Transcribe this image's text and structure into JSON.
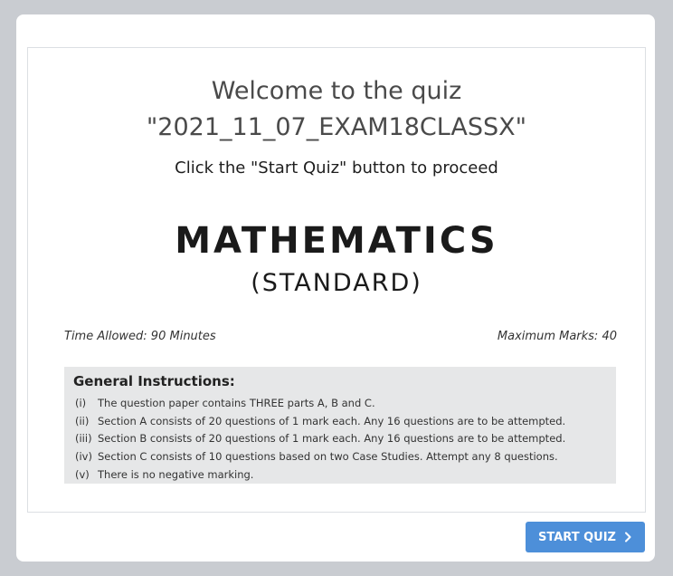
{
  "quiz": {
    "welcome_line": "Welcome to the quiz",
    "quiz_name": "\"2021_11_07_EXAM18CLASSX\"",
    "subtitle": "Click the \"Start Quiz\" button to proceed"
  },
  "paper": {
    "subject": "MATHEMATICS",
    "variant": "(STANDARD)",
    "time_allowed": "Time Allowed: 90 Minutes",
    "max_marks": "Maximum Marks: 40",
    "instructions_title": "General Instructions:",
    "instructions": [
      {
        "num": "(i)",
        "text": "The question paper contains THREE parts A, B and C."
      },
      {
        "num": "(ii)",
        "text": "Section A consists of 20 questions of 1 mark each. Any 16 questions are to be attempted."
      },
      {
        "num": "(iii)",
        "text": "Section B consists of 20 questions of 1 mark each. Any 16 questions are to be attempted."
      },
      {
        "num": "(iv)",
        "text": "Section C consists of 10 questions based on two Case Studies. Attempt any 8 questions."
      },
      {
        "num": "(v)",
        "text": "There is no negative marking."
      }
    ]
  },
  "actions": {
    "start_label": "START QUIZ",
    "start_icon": "chevron-right-icon"
  },
  "colors": {
    "page_background": "#c9ccd1",
    "button": "#4d8fd9",
    "instructions_background": "#e6e7e8"
  }
}
